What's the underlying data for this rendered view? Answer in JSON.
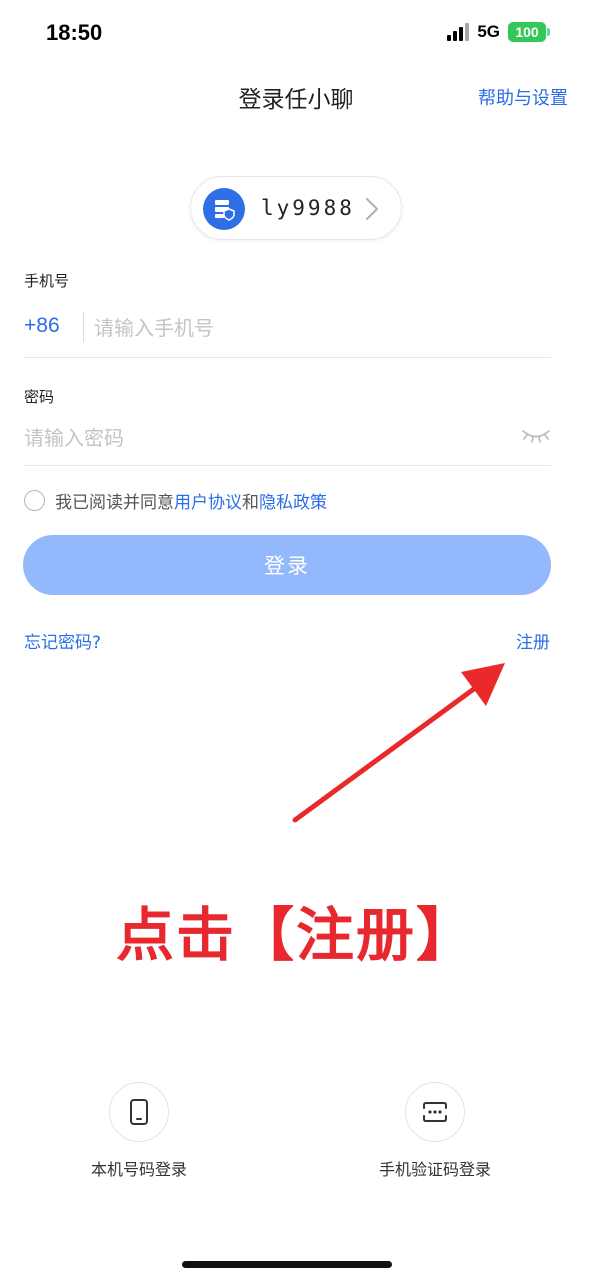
{
  "status_bar": {
    "time": "18:50",
    "network": "5G",
    "battery": "100"
  },
  "nav": {
    "title": "登录任小聊",
    "help_settings": "帮助与设置"
  },
  "server": {
    "name": "ly9988",
    "icon": "server-shield-icon"
  },
  "phone": {
    "label": "手机号",
    "country_code": "+86",
    "placeholder": "请输入手机号",
    "value": ""
  },
  "password": {
    "label": "密码",
    "placeholder": "请输入密码",
    "value": "",
    "icon": "eye-closed-icon"
  },
  "agreement": {
    "prefix": "我已阅读并同意",
    "user_agreement": "用户协议",
    "and": "和",
    "privacy_policy": "隐私政策",
    "checked": false
  },
  "login_button": "登录",
  "forgot_password": "忘记密码?",
  "register": "注册",
  "annotation": {
    "text": "点击【注册】",
    "color": "#e8282f"
  },
  "alt_logins": [
    {
      "label": "本机号码登录",
      "icon": "mobile-phone-icon"
    },
    {
      "label": "手机验证码登录",
      "icon": "sms-code-icon"
    }
  ],
  "colors": {
    "accent": "#2b6de8",
    "login_button": "#93b8fb",
    "battery": "#34c759"
  }
}
